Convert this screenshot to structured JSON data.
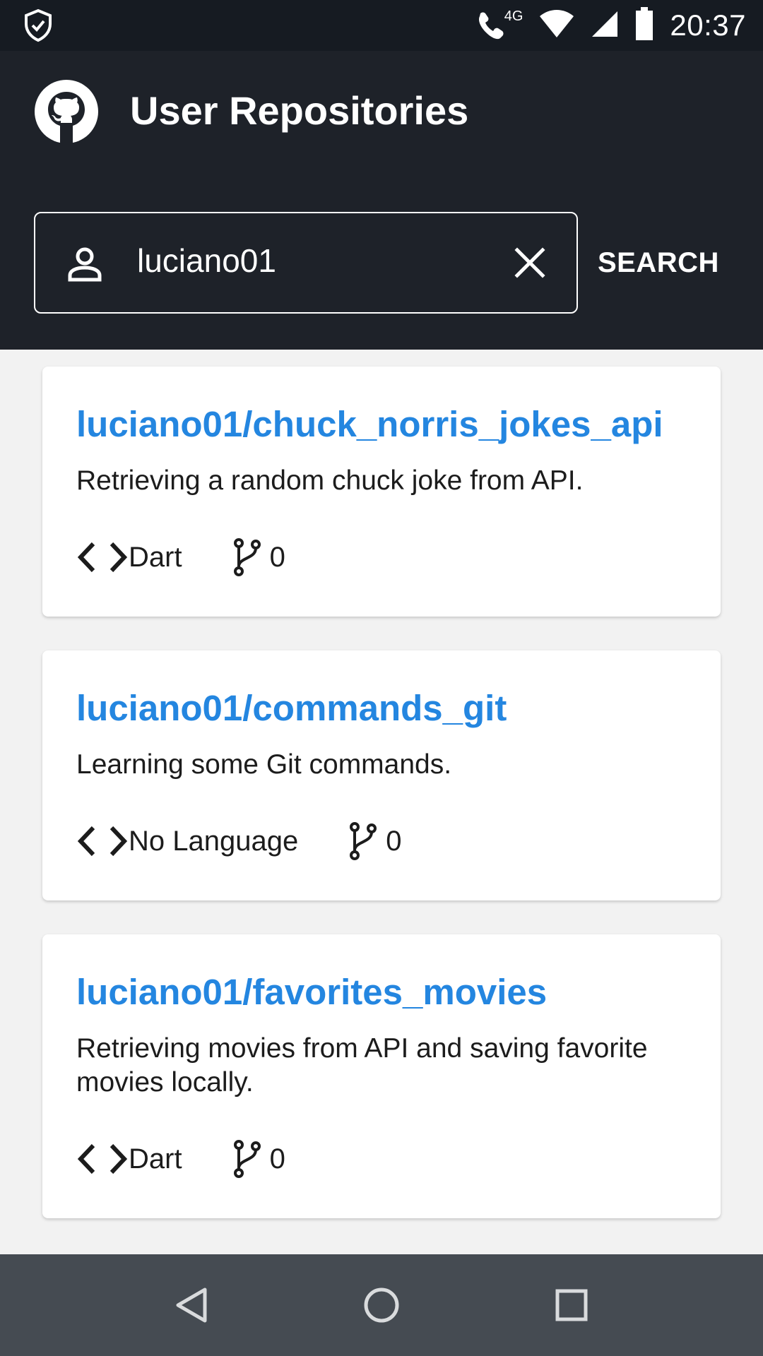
{
  "status_bar": {
    "time": "20:37",
    "network": "4G",
    "icons": [
      "shield-check-icon",
      "wifi-call-icon",
      "wifi-icon",
      "signal-icon",
      "battery-icon"
    ]
  },
  "app_bar": {
    "logo": "github-icon",
    "title": "User Repositories",
    "search": {
      "value": "luciano01",
      "icon": "user-icon",
      "clear_icon": "close-icon"
    },
    "search_button": "SEARCH"
  },
  "repositories": [
    {
      "name": "luciano01/chuck_norris_jokes_api",
      "description": "Retrieving a random chuck joke from API.",
      "language": "Dart",
      "forks": "0"
    },
    {
      "name": "luciano01/commands_git",
      "description": "Learning some Git commands.",
      "language": "No Language",
      "forks": "0"
    },
    {
      "name": "luciano01/favorites_movies",
      "description": "Retrieving movies from API and saving favorite movies locally.",
      "language": "Dart",
      "forks": "0"
    }
  ],
  "nav_bar": {
    "buttons": [
      "back-icon",
      "home-icon",
      "recents-icon"
    ]
  },
  "colors": {
    "app_bar": "#1e2229",
    "status_bar": "#161b22",
    "link": "#2486e0",
    "background": "#f2f2f2",
    "nav_bar": "#454b52"
  }
}
